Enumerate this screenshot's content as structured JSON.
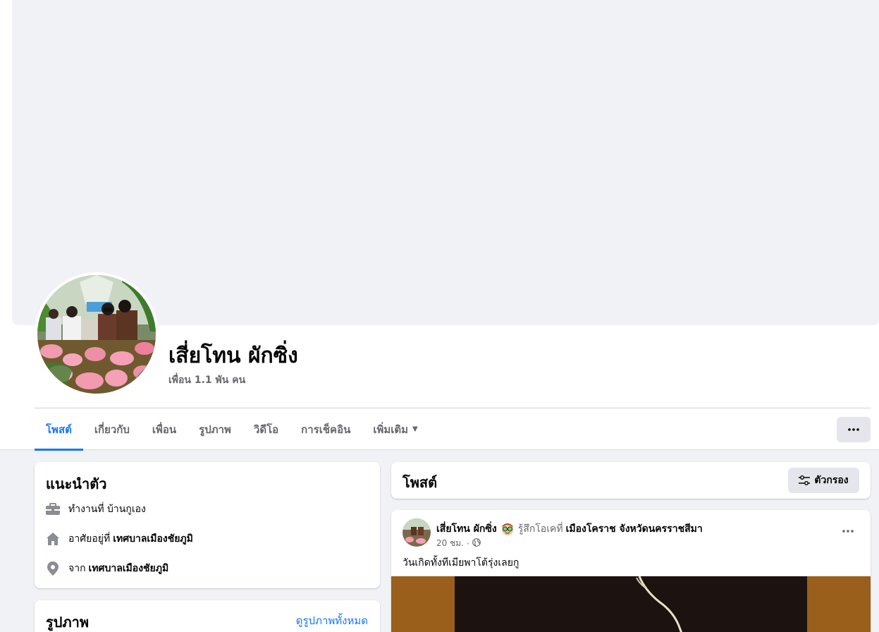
{
  "profile": {
    "name": "เสี่ยโทน ผักซิ่ง",
    "friends": "เพื่อน 1.1 พัน คน"
  },
  "tabs": [
    {
      "label": "โพสต์",
      "active": true
    },
    {
      "label": "เกี่ยวกับ",
      "active": false
    },
    {
      "label": "เพื่อน",
      "active": false
    },
    {
      "label": "รูปภาพ",
      "active": false
    },
    {
      "label": "วิดีโอ",
      "active": false
    },
    {
      "label": "การเช็คอิน",
      "active": false
    },
    {
      "label": "เพิ่มเติม",
      "active": false,
      "icon": "caret-down-icon"
    }
  ],
  "intro": {
    "title": "แนะนำตัว",
    "work": {
      "icon": "briefcase-icon",
      "text": "ทำงานที่ บ้านกูเอง"
    },
    "lives": {
      "icon": "home-icon",
      "prefix": "อาศัยอยู่ที่",
      "place": "เทศบาลเมืองชัยภูมิ"
    },
    "from": {
      "icon": "location-pin-icon",
      "prefix": "จาก",
      "place": "เทศบาลเมืองชัยภูมิ"
    }
  },
  "photos": {
    "title": "รูปภาพ",
    "see_all": "ดูรูปภาพทั้งหมด"
  },
  "posts_header": {
    "title": "โพสต์",
    "filter_label": "ตัวกรอง",
    "filter_icon": "sliders-icon"
  },
  "post": {
    "author": "เสี่ยโทน ผักซิ่ง",
    "feeling": "รู้สึกโอเคที่",
    "feeling_icon": "nerd-face-emoji",
    "place": "เมืองโคราช จังหวัดนครราชสีมา",
    "time": "20 ชม.",
    "dot": "·",
    "privacy_icon": "globe-icon",
    "text": "วันเกิดทั้งทีเมียพาโต้รุ่งเลยกู"
  },
  "colors": {
    "accent": "#1877f2",
    "background": "#f0f2f5",
    "secondary_text": "#65676b",
    "button_bg": "#e4e6eb"
  }
}
